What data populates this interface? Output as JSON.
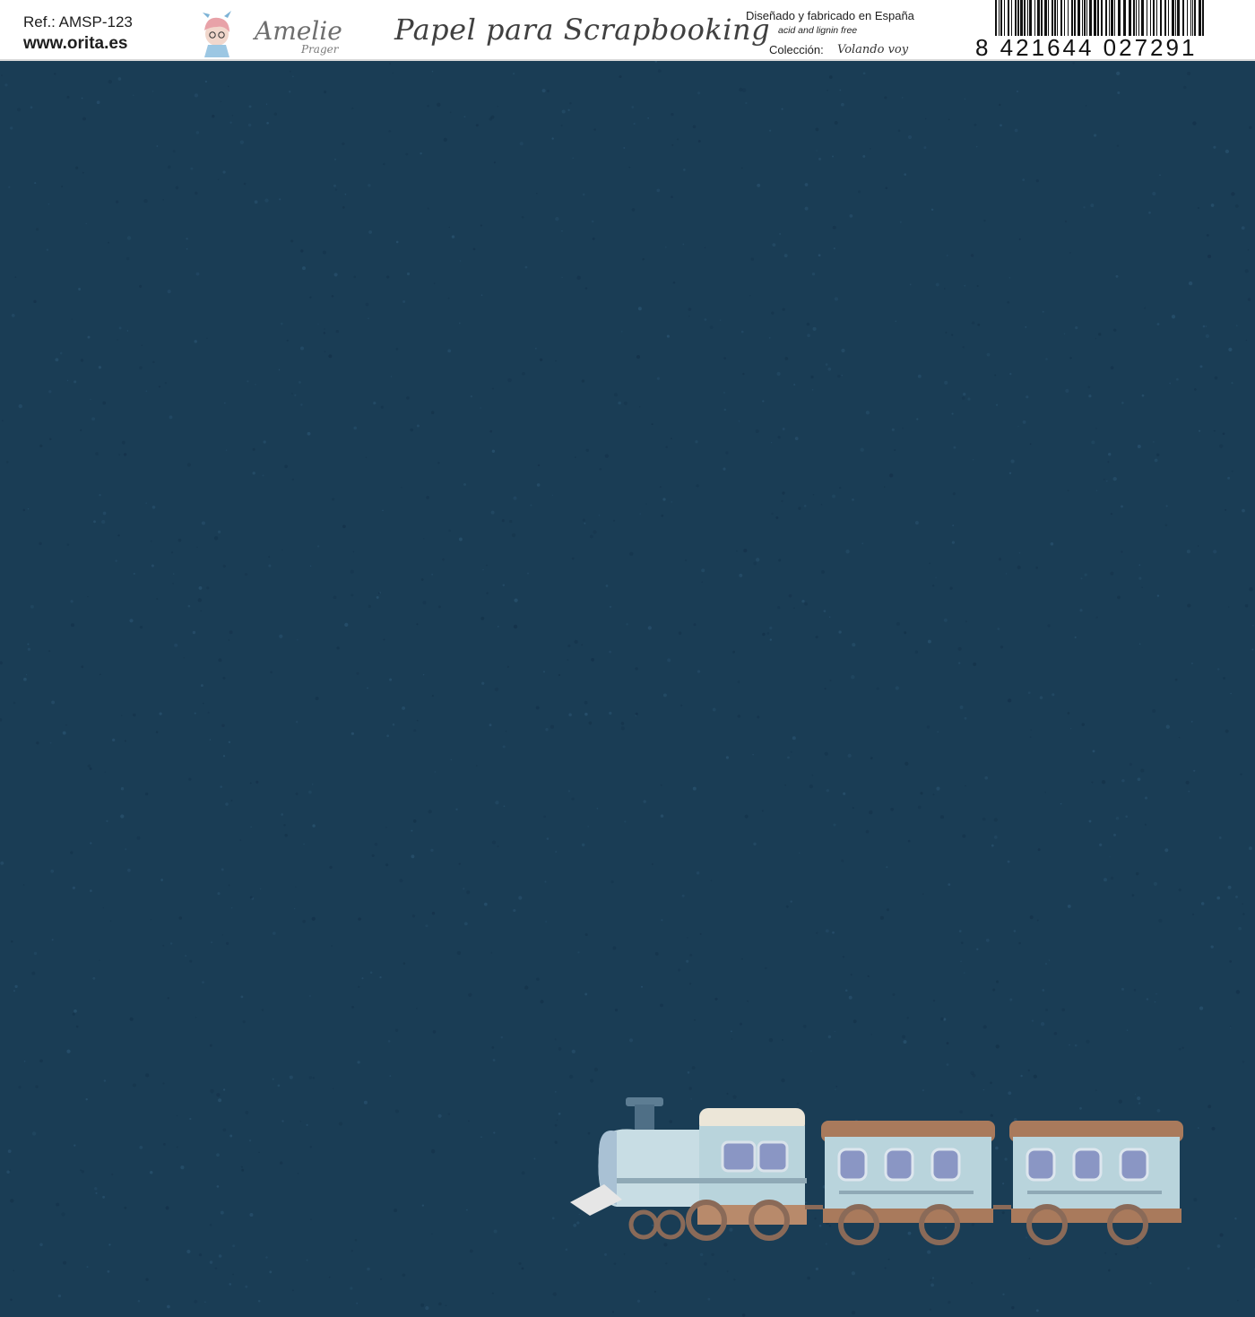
{
  "header": {
    "ref": "Ref.: AMSP-123",
    "website": "www.orita.es",
    "logo_text": "Amelie",
    "logo_sub": "Prager",
    "title": "Papel para Scrapbooking",
    "made_in": "Diseñado y fabricado en España",
    "acid_free": "acid and lignin free",
    "collection_label": "Colección:",
    "collection_value": "Volando voy",
    "barcode_number": "8 421644 027291"
  },
  "paper": {
    "background_color": "#1a3d55",
    "illustration": "watercolor-train-icon"
  },
  "colors": {
    "paper": "#1a3d55",
    "train_body": "#b9d4dc",
    "train_roof": "#a97a5c",
    "wheels": "#8a6a58"
  }
}
